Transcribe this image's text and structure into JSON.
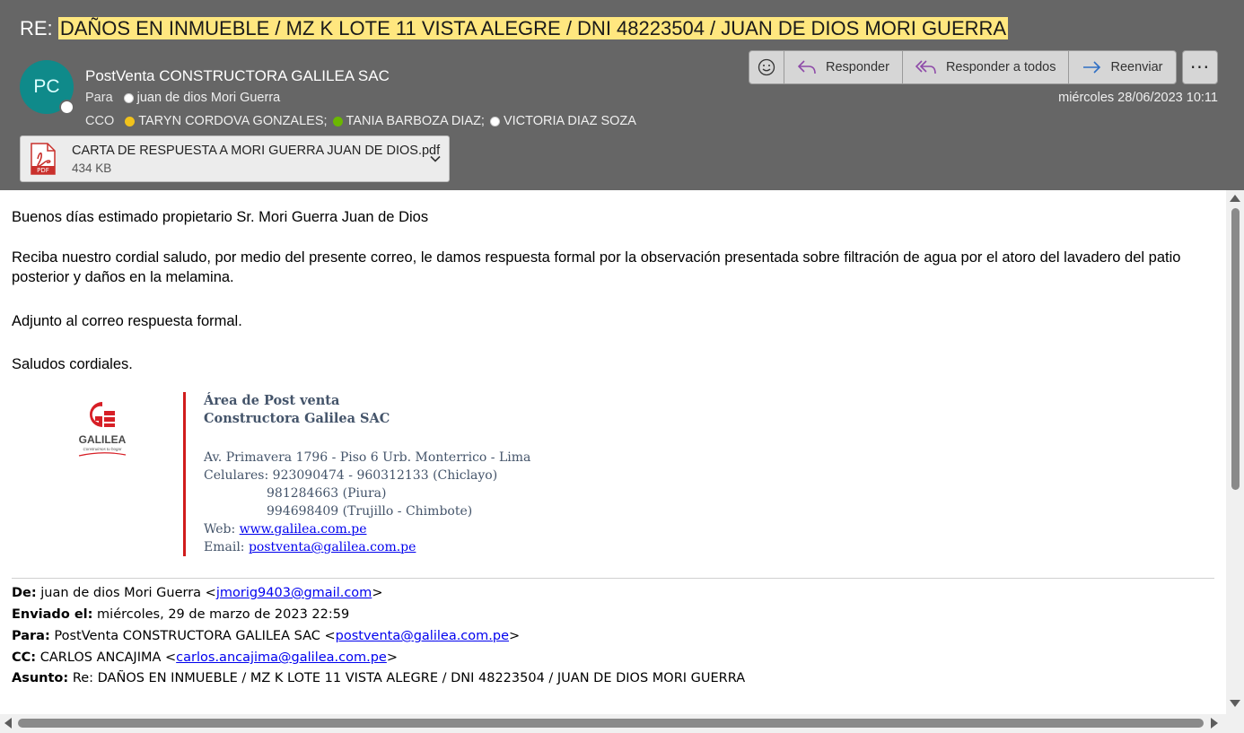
{
  "header": {
    "subject_prefix": "RE:",
    "subject_highlight": "DAÑOS EN INMUEBLE / MZ K LOTE 11 VISTA ALEGRE / DNI 48223504 / JUAN DE DIOS MORI GUERRA",
    "avatar_initials": "PC",
    "sender": "PostVenta CONSTRUCTORA GALILEA SAC",
    "to_label": "Para",
    "to": [
      {
        "name": "juan de dios Mori Guerra",
        "status": "white"
      }
    ],
    "bcc_label": "CCO",
    "bcc": [
      {
        "name": "TARYN CORDOVA GONZALES;",
        "status": "yellow"
      },
      {
        "name": "TANIA BARBOZA DIAZ;",
        "status": "green"
      },
      {
        "name": "VICTORIA DIAZ SOZA",
        "status": "white"
      }
    ],
    "date": "miércoles 28/06/2023 10:11",
    "attachment": {
      "name": "CARTA DE RESPUESTA A MORI GUERRA JUAN DE DIOS.pdf",
      "size": "434 KB",
      "icon": "pdf-icon",
      "icon_text": "PDF"
    },
    "actions": {
      "emoji_icon": "smiley-icon",
      "reply": "Responder",
      "reply_all": "Responder a todos",
      "forward": "Reenviar",
      "more": "···"
    }
  },
  "body": {
    "greeting": "Buenos días estimado propietario Sr. Mori Guerra Juan de Dios",
    "paragraph": "Reciba nuestro cordial saludo, por medio del presente correo, le damos respuesta formal por la observación presentada sobre filtración de agua por el atoro del lavadero del patio posterior y daños en la melamina.",
    "attached_line": "Adjunto al correo respuesta formal.",
    "closing": "Saludos cordiales."
  },
  "signature": {
    "logo_text": "GALILEA",
    "logo_tagline": "Construimos tu hogar",
    "area": "Área de Post venta",
    "company": "Constructora Galilea SAC",
    "address": "Av. Primavera 1796 - Piso 6 Urb. Monterrico - Lima",
    "phones_label": "Celulares:",
    "phones": [
      "923090474 - 960312133 (Chiclayo)",
      "981284663 (Piura)",
      "994698409 (Trujillo - Chimbote)"
    ],
    "web_label": "Web:",
    "web": "www.galilea.com.pe",
    "email_label": "Email:",
    "email": "postventa@galilea.com.pe"
  },
  "quoted": {
    "from_label": "De:",
    "from_name": "juan de dios Mori Guerra <",
    "from_email": "jmorig9403@gmail.com",
    "from_close": ">",
    "sent_label": "Enviado el:",
    "sent": "miércoles, 29 de marzo de 2023 22:59",
    "to_label": "Para:",
    "to_name": "PostVenta CONSTRUCTORA GALILEA SAC <",
    "to_email": "postventa@galilea.com.pe",
    "to_close": ">",
    "cc_label": "CC:",
    "cc_name": "CARLOS ANCAJIMA <",
    "cc_email": "carlos.ancajima@galilea.com.pe",
    "cc_close": ">",
    "subject_label": "Asunto:",
    "subject": "Re: DAÑOS EN INMUEBLE / MZ K LOTE 11 VISTA ALEGRE / DNI 48223504 / JUAN DE DIOS MORI GUERRA"
  },
  "colors": {
    "header_bg": "#666666",
    "highlight": "#ffe77f",
    "avatar_bg": "#0f8a8a",
    "signature_bar": "#d01c1c",
    "signature_text": "#44546a",
    "link": "#0000ee"
  }
}
